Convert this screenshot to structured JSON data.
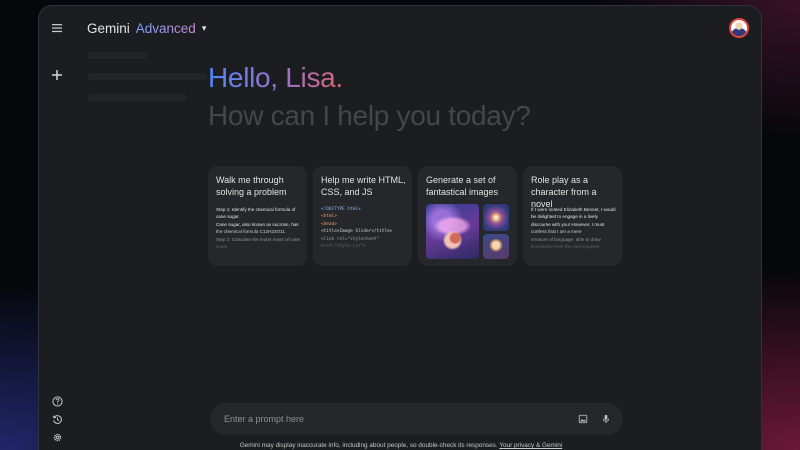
{
  "header": {
    "brand": "Gemini",
    "tier": "Advanced",
    "dropdown_caret": "▾"
  },
  "greeting": {
    "hello": "Hello, Lisa.",
    "subtitle": "How can I help you today?"
  },
  "cards": [
    {
      "title": "Walk me through solving a problem",
      "body_lines": [
        "Step 1: Identify the chemical formula of cane sugar.",
        "Cane sugar, also known as sucrose, has the chemical formula C12H22O11.",
        "Step 2: Calculate the molar mass of cane sugar."
      ]
    },
    {
      "title": "Help me write HTML, CSS, and JS",
      "code_lines": [
        "<!DOCTYPE html>",
        "<html>",
        "<head>",
        "<title>Image Slider</title>",
        "<link rel=\"stylesheet\"",
        "href=\"style.css\">"
      ]
    },
    {
      "title": "Generate a set of fantastical images"
    },
    {
      "title": "Role play as a character from a novel",
      "body_lines": [
        "If I were indeed Elizabeth Bennet, I would be delighted to engage in a lively discourse with you! However, I must confess that I am a mere",
        "creature of language, able to draw knowledge from the vast expanse"
      ]
    }
  ],
  "prompt": {
    "placeholder": "Enter a prompt here"
  },
  "footer": {
    "disclaimer": "Gemini may display inaccurate info, including about people, so double-check its responses.",
    "link": "Your privacy & Gemini"
  },
  "colors": {
    "background": "#1c1d20",
    "card": "#26272a",
    "greeting_gradient_start": "#4f86f7",
    "greeting_gradient_end": "#d96570",
    "subtitle": "#444746"
  },
  "icons": {
    "menu": "menu-icon",
    "new_chat": "plus-icon",
    "help": "help-icon",
    "activity": "history-icon",
    "settings": "gear-icon",
    "image_upload": "image-icon",
    "mic": "mic-icon"
  }
}
